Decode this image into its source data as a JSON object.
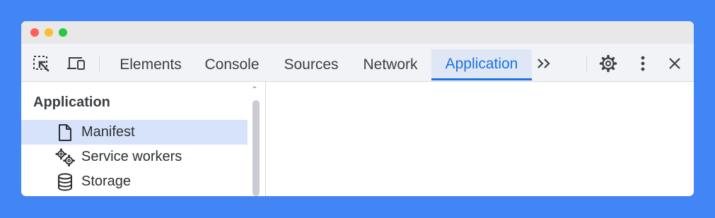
{
  "devtools": {
    "tabs": [
      "Elements",
      "Console",
      "Sources",
      "Network",
      "Application"
    ],
    "active_tab": "Application"
  },
  "toolbar_icons": {
    "inspect": "inspect-element-icon",
    "device": "device-toolbar-icon",
    "more_tabs": "chevron-double-right-icon",
    "settings": "gear-icon",
    "menu": "kebab-menu-icon",
    "close": "close-icon"
  },
  "sidebar": {
    "section_title": "Application",
    "items": [
      {
        "label": "Manifest",
        "icon": "file-icon",
        "selected": true
      },
      {
        "label": "Service workers",
        "icon": "gears-icon",
        "selected": false
      },
      {
        "label": "Storage",
        "icon": "database-icon",
        "selected": false
      }
    ]
  },
  "colors": {
    "background": "#4285f4",
    "accent": "#1a73e8",
    "selected_row": "#d7e3fb"
  }
}
